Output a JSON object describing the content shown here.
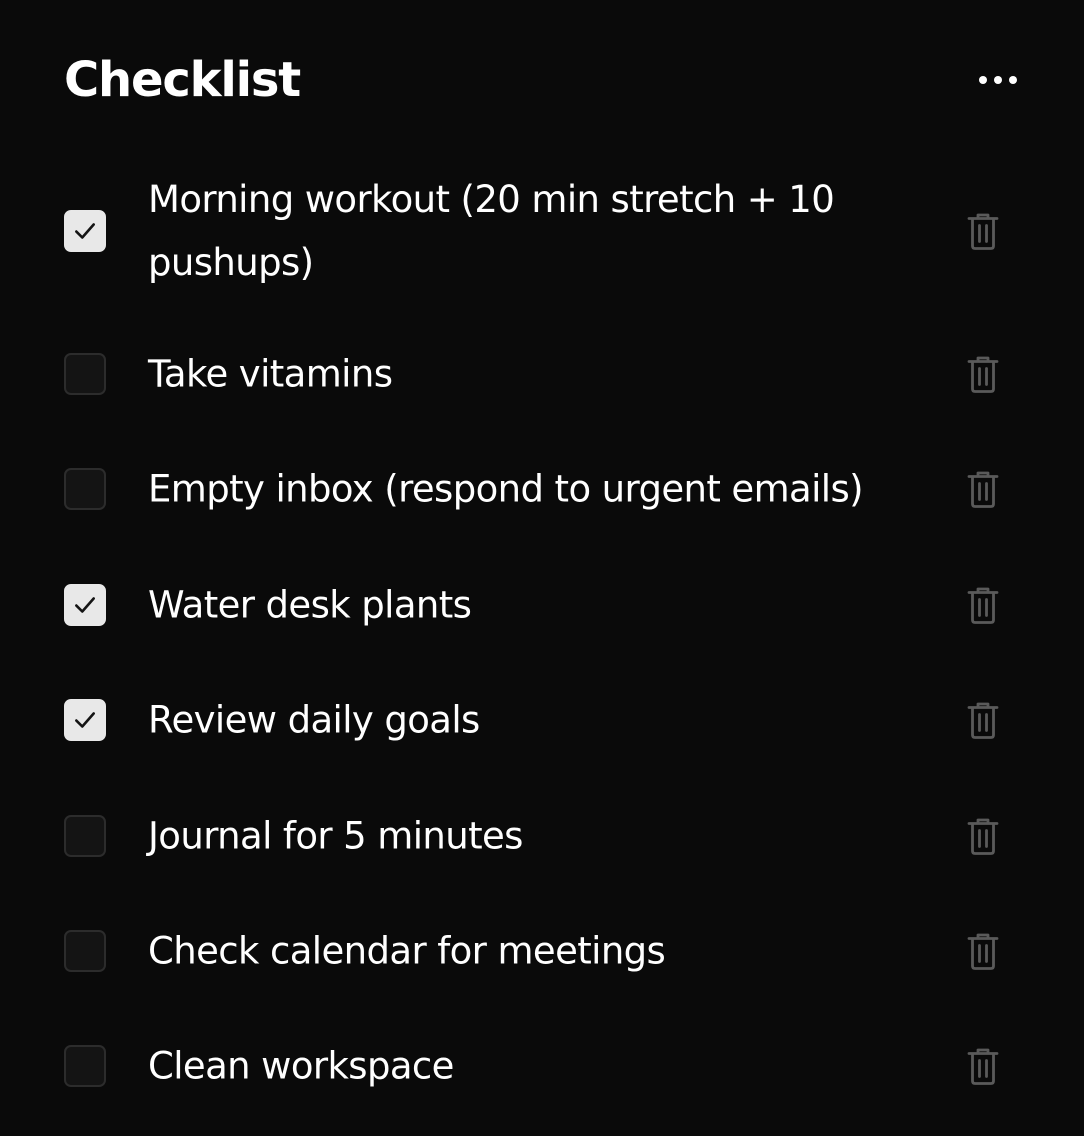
{
  "header": {
    "title": "Checklist",
    "more_icon": "more-horizontal-icon"
  },
  "items": [
    {
      "label": "Morning workout (20 min stretch + 10 pushups)",
      "checked": true
    },
    {
      "label": "Take vitamins",
      "checked": false
    },
    {
      "label": "Empty inbox (respond to urgent emails)",
      "checked": false
    },
    {
      "label": "Water desk plants",
      "checked": true
    },
    {
      "label": "Review daily goals",
      "checked": true
    },
    {
      "label": "Journal for 5 minutes",
      "checked": false
    },
    {
      "label": "Check calendar for meetings",
      "checked": false
    },
    {
      "label": "Clean workspace",
      "checked": false
    }
  ],
  "icons": {
    "checkbox_check": "check-icon",
    "delete": "trash-icon"
  },
  "colors": {
    "background": "#0a0a0a",
    "text": "#ffffff",
    "checkbox_checked": "#e8e8e8",
    "checkbox_unchecked_border": "#2c2c2c",
    "trash_icon": "#5a5a5a"
  }
}
